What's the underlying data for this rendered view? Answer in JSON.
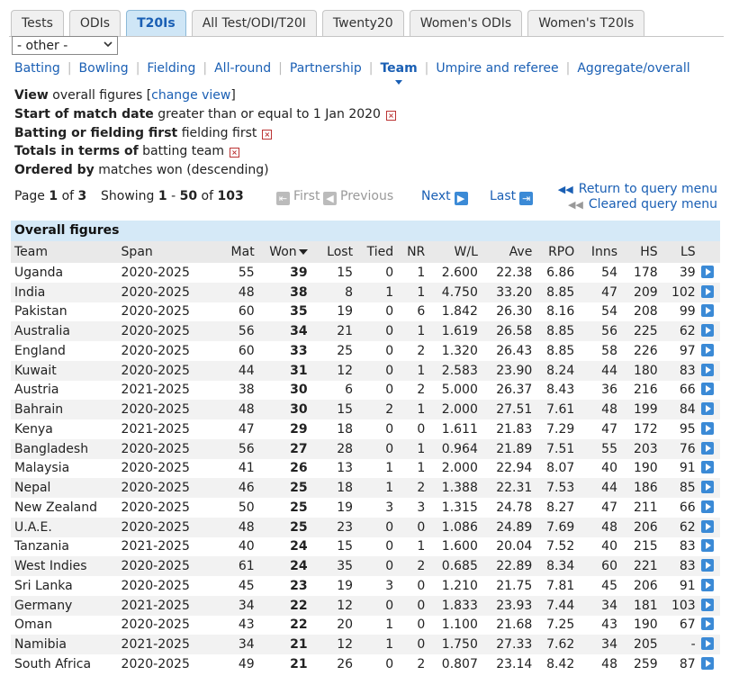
{
  "tabs": [
    "Tests",
    "ODIs",
    "T20Is",
    "All Test/ODI/T20I",
    "Twenty20",
    "Women's ODIs",
    "Women's T20Is"
  ],
  "active_tab": "T20Is",
  "select": {
    "value": "- other -"
  },
  "subnav": [
    "Batting",
    "Bowling",
    "Fielding",
    "All-round",
    "Partnership",
    "Team",
    "Umpire and referee",
    "Aggregate/overall"
  ],
  "active_subnav": "Team",
  "criteria": {
    "view_label": "View",
    "view_value": "overall figures [",
    "change_view": "change view",
    "view_close": "]",
    "date_label": "Start of match date",
    "date_value": "greater than or equal to 1 Jan 2020",
    "bat_label": "Batting or fielding first",
    "bat_value": "fielding first",
    "totals_label": "Totals in terms of",
    "totals_value": "batting team",
    "order_label": "Ordered by",
    "order_value": "matches won (descending)"
  },
  "pager": {
    "page_prefix": "Page",
    "page": "1",
    "of_word": "of",
    "pages": "3",
    "showing_prefix": "Showing",
    "from": "1",
    "dash": "-",
    "to": "50",
    "total": "103",
    "first": "First",
    "previous": "Previous",
    "next": "Next",
    "last": "Last"
  },
  "return_query": "Return to query menu",
  "cleared_query": "Cleared query menu",
  "table": {
    "caption": "Overall figures",
    "headers": [
      "Team",
      "Span",
      "Mat",
      "Won",
      "Lost",
      "Tied",
      "NR",
      "W/L",
      "Ave",
      "RPO",
      "Inns",
      "HS",
      "LS"
    ],
    "rows": [
      [
        "Uganda",
        "2020-2025",
        "55",
        "39",
        "15",
        "0",
        "1",
        "2.600",
        "22.38",
        "6.86",
        "54",
        "178",
        "39"
      ],
      [
        "India",
        "2020-2025",
        "48",
        "38",
        "8",
        "1",
        "1",
        "4.750",
        "33.20",
        "8.85",
        "47",
        "209",
        "102"
      ],
      [
        "Pakistan",
        "2020-2025",
        "60",
        "35",
        "19",
        "0",
        "6",
        "1.842",
        "26.30",
        "8.16",
        "54",
        "208",
        "99"
      ],
      [
        "Australia",
        "2020-2025",
        "56",
        "34",
        "21",
        "0",
        "1",
        "1.619",
        "26.58",
        "8.85",
        "56",
        "225",
        "62"
      ],
      [
        "England",
        "2020-2025",
        "60",
        "33",
        "25",
        "0",
        "2",
        "1.320",
        "26.43",
        "8.85",
        "58",
        "226",
        "97"
      ],
      [
        "Kuwait",
        "2020-2025",
        "44",
        "31",
        "12",
        "0",
        "1",
        "2.583",
        "23.90",
        "8.24",
        "44",
        "180",
        "83"
      ],
      [
        "Austria",
        "2021-2025",
        "38",
        "30",
        "6",
        "0",
        "2",
        "5.000",
        "26.37",
        "8.43",
        "36",
        "216",
        "66"
      ],
      [
        "Bahrain",
        "2020-2025",
        "48",
        "30",
        "15",
        "2",
        "1",
        "2.000",
        "27.51",
        "7.61",
        "48",
        "199",
        "84"
      ],
      [
        "Kenya",
        "2021-2025",
        "47",
        "29",
        "18",
        "0",
        "0",
        "1.611",
        "21.83",
        "7.29",
        "47",
        "172",
        "95"
      ],
      [
        "Bangladesh",
        "2020-2025",
        "56",
        "27",
        "28",
        "0",
        "1",
        "0.964",
        "21.89",
        "7.51",
        "55",
        "203",
        "76"
      ],
      [
        "Malaysia",
        "2020-2025",
        "41",
        "26",
        "13",
        "1",
        "1",
        "2.000",
        "22.94",
        "8.07",
        "40",
        "190",
        "91"
      ],
      [
        "Nepal",
        "2020-2025",
        "46",
        "25",
        "18",
        "1",
        "2",
        "1.388",
        "22.31",
        "7.53",
        "44",
        "186",
        "85"
      ],
      [
        "New Zealand",
        "2020-2025",
        "50",
        "25",
        "19",
        "3",
        "3",
        "1.315",
        "24.78",
        "8.27",
        "47",
        "211",
        "66"
      ],
      [
        "U.A.E.",
        "2020-2025",
        "48",
        "25",
        "23",
        "0",
        "0",
        "1.086",
        "24.89",
        "7.69",
        "48",
        "206",
        "62"
      ],
      [
        "Tanzania",
        "2021-2025",
        "40",
        "24",
        "15",
        "0",
        "1",
        "1.600",
        "20.04",
        "7.52",
        "40",
        "215",
        "83"
      ],
      [
        "West Indies",
        "2020-2025",
        "61",
        "24",
        "35",
        "0",
        "2",
        "0.685",
        "22.89",
        "8.34",
        "60",
        "221",
        "83"
      ],
      [
        "Sri Lanka",
        "2020-2025",
        "45",
        "23",
        "19",
        "3",
        "0",
        "1.210",
        "21.75",
        "7.81",
        "45",
        "206",
        "91"
      ],
      [
        "Germany",
        "2021-2025",
        "34",
        "22",
        "12",
        "0",
        "0",
        "1.833",
        "23.93",
        "7.44",
        "34",
        "181",
        "103"
      ],
      [
        "Oman",
        "2020-2025",
        "43",
        "22",
        "20",
        "1",
        "0",
        "1.100",
        "21.68",
        "7.25",
        "43",
        "190",
        "67"
      ],
      [
        "Namibia",
        "2021-2025",
        "34",
        "21",
        "12",
        "1",
        "0",
        "1.750",
        "27.33",
        "7.62",
        "34",
        "205",
        "-"
      ],
      [
        "South Africa",
        "2020-2025",
        "49",
        "21",
        "26",
        "0",
        "2",
        "0.807",
        "23.14",
        "8.42",
        "48",
        "259",
        "87"
      ]
    ]
  }
}
